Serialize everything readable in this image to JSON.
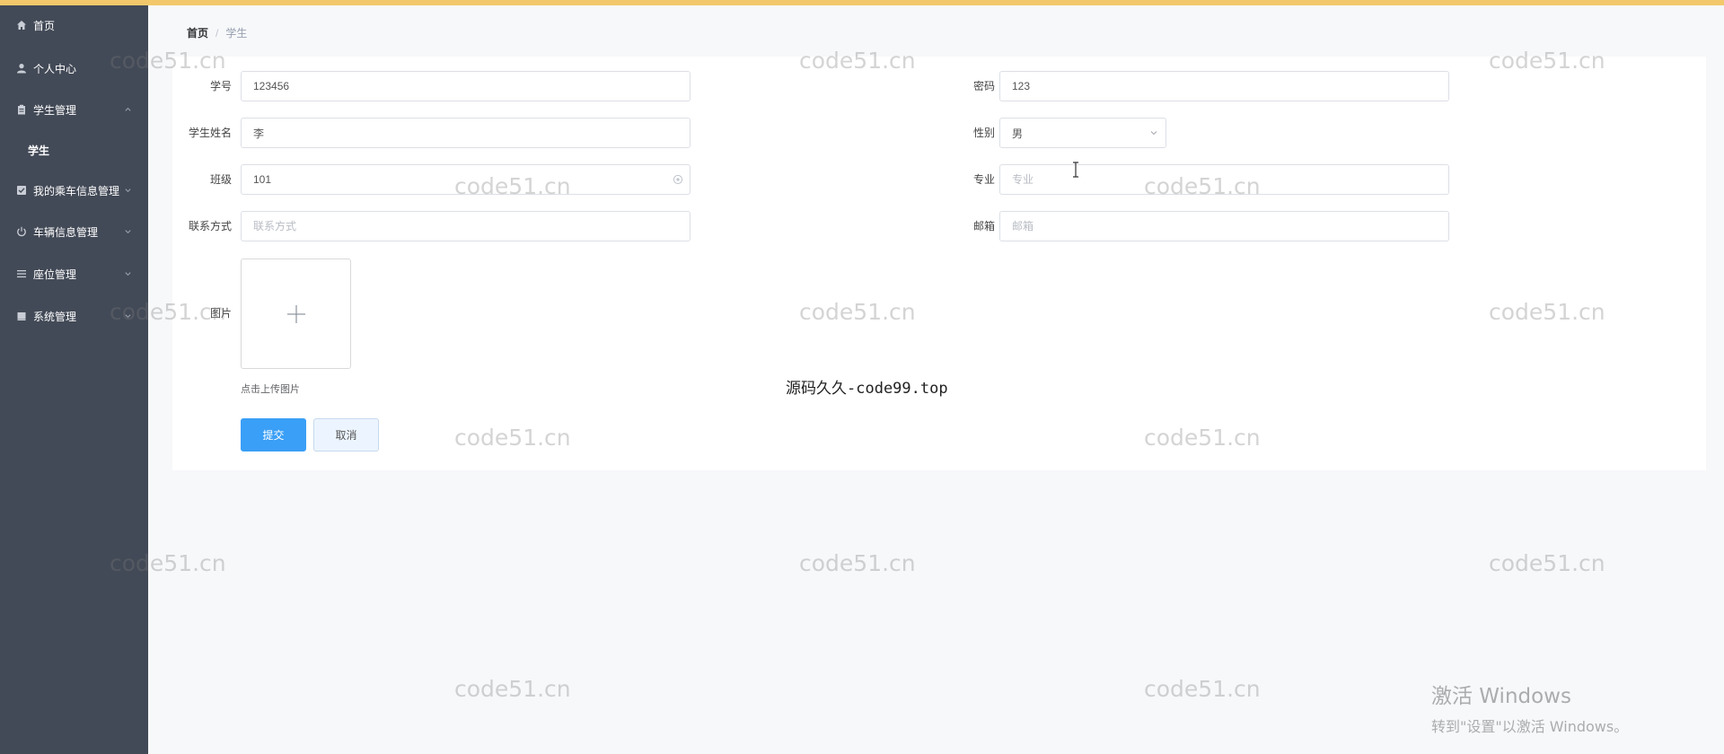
{
  "sidebar": {
    "items": [
      {
        "label": "首页",
        "icon": "home-icon"
      },
      {
        "label": "个人中心",
        "icon": "user-icon"
      },
      {
        "label": "学生管理",
        "icon": "clipboard-icon",
        "expanded": true,
        "children": [
          {
            "label": "学生"
          }
        ]
      },
      {
        "label": "我的乘车信息管理",
        "icon": "checkbox-icon"
      },
      {
        "label": "车辆信息管理",
        "icon": "power-icon"
      },
      {
        "label": "座位管理",
        "icon": "list-icon"
      },
      {
        "label": "系统管理",
        "icon": "bookmark-icon"
      }
    ]
  },
  "breadcrumb": {
    "home": "首页",
    "separator": "/",
    "current": "学生"
  },
  "form": {
    "student_id": {
      "label": "学号",
      "value": "123456"
    },
    "password": {
      "label": "密码",
      "value": "123"
    },
    "name": {
      "label": "学生姓名",
      "value": "李"
    },
    "gender": {
      "label": "性别",
      "value": "男"
    },
    "class": {
      "label": "班级",
      "value": "101"
    },
    "major": {
      "label": "专业",
      "value": "",
      "placeholder": "专业"
    },
    "contact": {
      "label": "联系方式",
      "value": "",
      "placeholder": "联系方式"
    },
    "email": {
      "label": "邮箱",
      "value": "",
      "placeholder": "邮箱"
    },
    "picture": {
      "label": "图片",
      "tip": "点击上传图片"
    },
    "submit_label": "提交",
    "cancel_label": "取消"
  },
  "watermark": {
    "text": "code51.cn"
  },
  "center_text": "源码久久-code99.top",
  "os_notice": {
    "title": "激活 Windows",
    "subtitle": "转到\"设置\"以激活 Windows。"
  },
  "colors": {
    "sidebar_bg": "#434a57",
    "primary": "#3a9ff6",
    "top_bar": "#f3c86b"
  }
}
